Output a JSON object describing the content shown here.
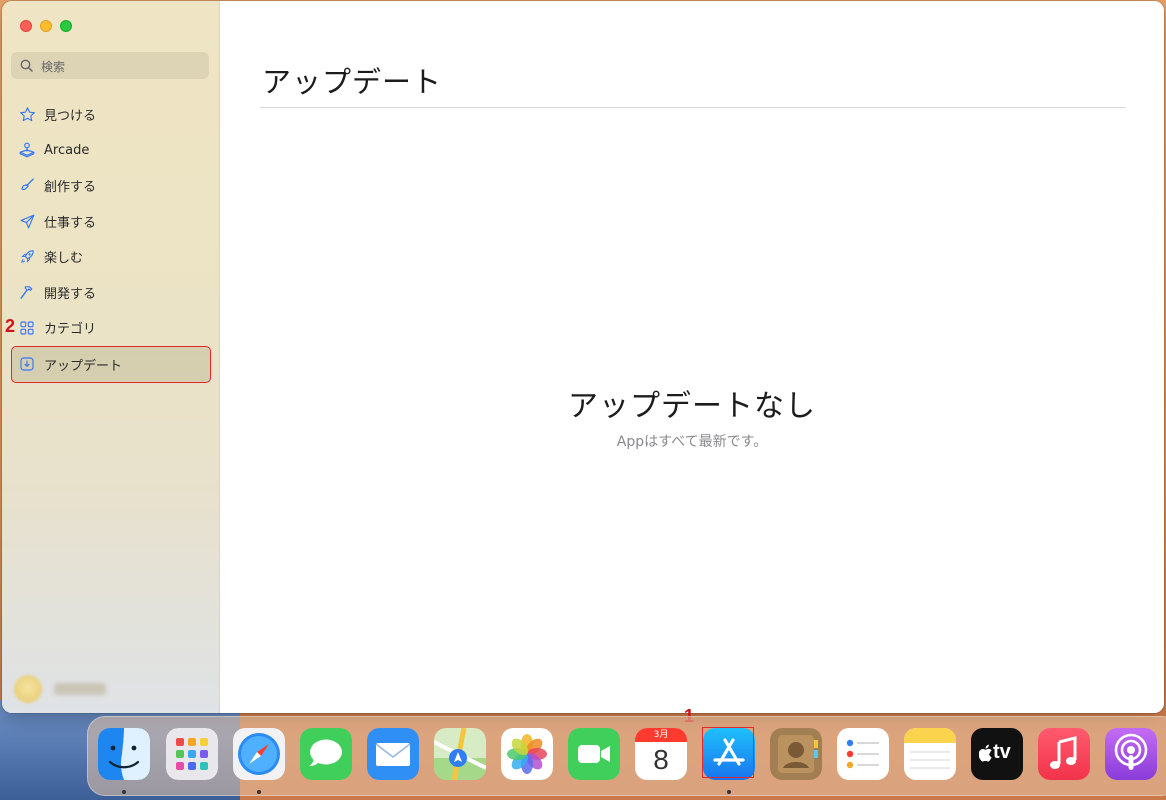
{
  "window": {
    "search_placeholder": "検索",
    "page_title": "アップデート",
    "empty_title": "アップデートなし",
    "empty_subtitle": "Appはすべて最新です。"
  },
  "sidebar": {
    "items": [
      {
        "label": "見つける",
        "icon": "star-icon"
      },
      {
        "label": "Arcade",
        "icon": "joystick-icon"
      },
      {
        "label": "創作する",
        "icon": "brush-icon"
      },
      {
        "label": "仕事する",
        "icon": "paper-plane-icon"
      },
      {
        "label": "楽しむ",
        "icon": "rocket-icon"
      },
      {
        "label": "開発する",
        "icon": "hammer-icon"
      },
      {
        "label": "カテゴリ",
        "icon": "grid-icon"
      },
      {
        "label": "アップデート",
        "icon": "download-icon",
        "selected": true
      }
    ]
  },
  "annotations": {
    "step1": "1",
    "step2": "2"
  },
  "dock": {
    "calendar_month": "3月",
    "calendar_day": "8",
    "tv_label": "tv",
    "apps": [
      "finder-icon",
      "launchpad-icon",
      "safari-icon",
      "messages-icon",
      "mail-icon",
      "maps-icon",
      "photos-icon",
      "facetime-icon",
      "calendar-icon",
      "app-store-icon",
      "contacts-icon",
      "reminders-icon",
      "notes-icon",
      "apple-tv-icon",
      "music-icon",
      "podcasts-icon"
    ]
  },
  "colors": {
    "accent": "#3478f6",
    "annotation": "#d0121b"
  }
}
